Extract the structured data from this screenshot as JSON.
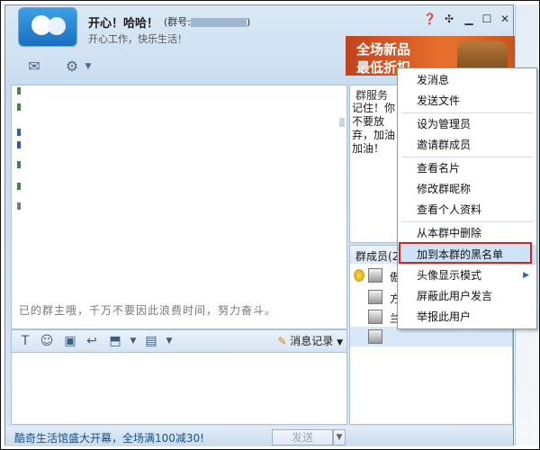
{
  "header": {
    "title": "开心！哈哈！",
    "group_number_label": "(群号:",
    "group_number_tail": ")",
    "subtitle": "开心工作，快乐生活！",
    "window_buttons": [
      "help-icon",
      "pin-icon",
      "minimize-icon",
      "maximize-icon",
      "close-icon"
    ]
  },
  "ad": {
    "line1": "全场新品",
    "line2": "最低折扣"
  },
  "chat": {
    "visible_tail": "已的群主哦，千万不要因此浪费时间，努力奋斗。"
  },
  "notice": {
    "title": "群服务",
    "text": "记住！你不要放弃，加油加油！"
  },
  "input_toolbar": {
    "history_label": "消息记录"
  },
  "members": {
    "title": "群成员",
    "title_count": "(2",
    "rows": [
      {
        "name": "傲"
      },
      {
        "name": "方"
      },
      {
        "name": "兰"
      },
      {
        "name": ""
      }
    ]
  },
  "bottom": {
    "promo": "酷奇生活馆盛大开幕，全场满100减30!",
    "send_label": "发送"
  },
  "context_menu": {
    "items": [
      "发消息",
      "发送文件",
      "设为管理员",
      "邀请群成员",
      "查看名片",
      "修改群昵称",
      "查看个人资料",
      "从本群中删除",
      "加到本群的黑名单",
      "头像显示模式",
      "屏蔽此用户发言",
      "举报此用户"
    ],
    "highlighted_index": 8
  },
  "colors": {
    "highlight_border": "#d9221e",
    "window_bg": "#c9dcef",
    "accent": "#1a4f8a"
  }
}
